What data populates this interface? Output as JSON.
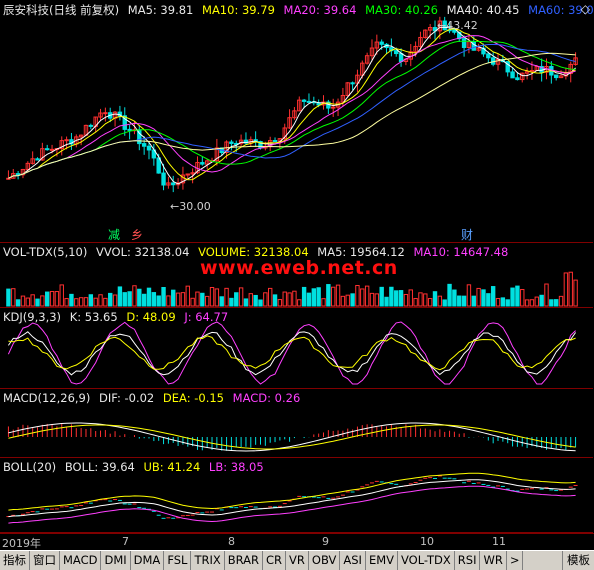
{
  "main": {
    "title": "辰安科技(日线 前复权)",
    "ma5": "MA5: 39.81",
    "ma10": "MA10: 39.79",
    "ma20": "MA20: 39.64",
    "ma30": "MA30: 40.26",
    "ma40": "MA40: 40.45",
    "ma60": "MA60: 39.0",
    "high_label": "43.42",
    "low_label": "30.00",
    "marker_left": "减",
    "marker_left_red": "乡",
    "marker_right": "财"
  },
  "vol": {
    "title": "VOL-TDX(5,10)",
    "vvol": "VVOL: 32138.04",
    "volume": "VOLUME: 32138.04",
    "ma5": "MA5: 19564.12",
    "ma10": "MA10: 14647.48"
  },
  "watermark": "www.eweb.net.cn",
  "kdj": {
    "title": "KDJ(9,3,3)",
    "k": "K: 53.65",
    "d": "D: 48.09",
    "j": "J: 64.77"
  },
  "macd": {
    "title": "MACD(12,26,9)",
    "dif": "DIF: -0.02",
    "dea": "DEA: -0.15",
    "macd": "MACD: 0.26"
  },
  "boll": {
    "title": "BOLL(20)",
    "boll": "BOLL: 39.64",
    "ub": "UB: 41.24",
    "lb": "LB: 38.05"
  },
  "date_axis": [
    "2019年",
    "7",
    "8",
    "9",
    "10",
    "11"
  ],
  "tabs": [
    "指标",
    "窗口",
    "MACD",
    "DMI",
    "DMA",
    "FSL",
    "TRIX",
    "BRAR",
    "CR",
    "VR",
    "OBV",
    "ASI",
    "EMV",
    "VOL-TDX",
    "RSI",
    "WR",
    ">",
    "模板"
  ],
  "colors": {
    "background": "#000000",
    "up": "#ff3030",
    "down": "#00e0e0",
    "ma5": "#ffffff",
    "ma10": "#ffff00",
    "ma20": "#ff40ff",
    "ma30": "#00ff00",
    "ma40": "#3060ff",
    "ma60": "#ffffa0"
  }
}
